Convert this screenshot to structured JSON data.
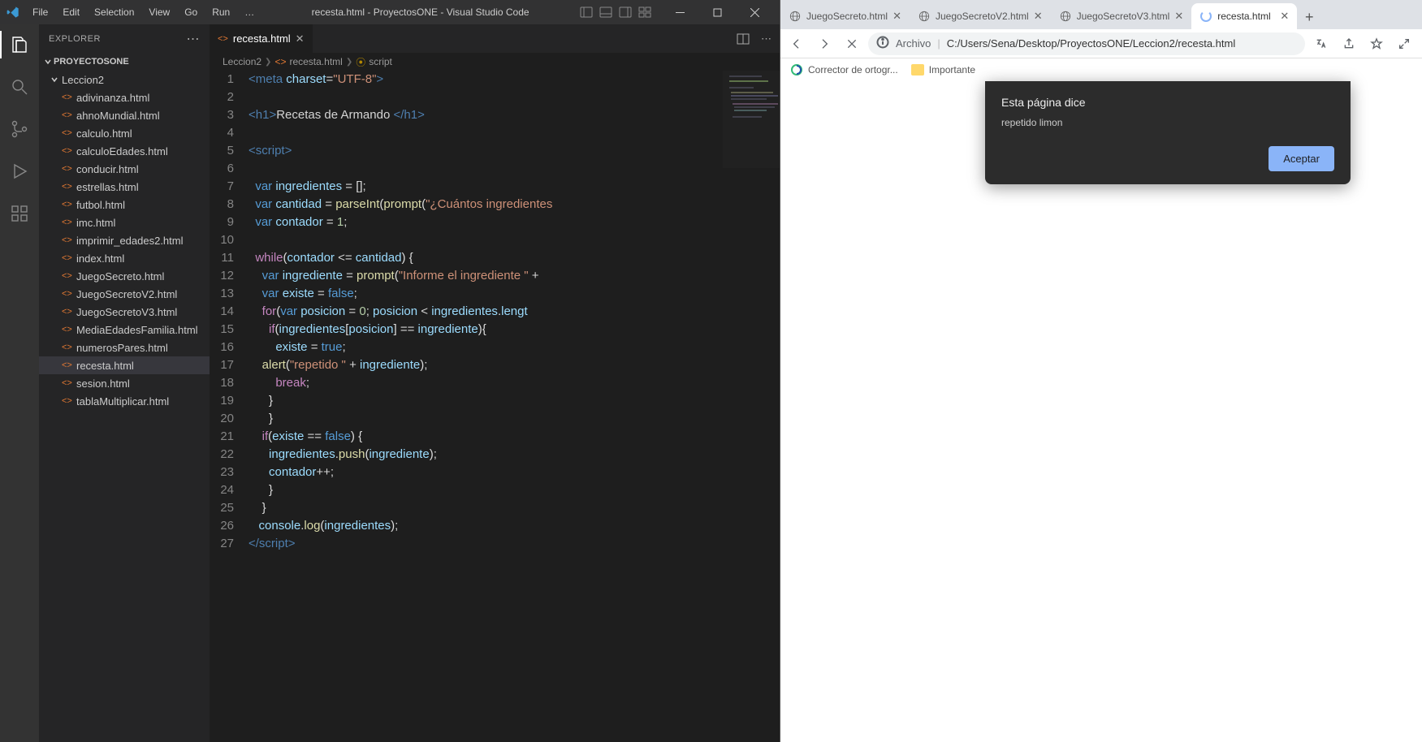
{
  "vscode": {
    "menus": [
      "File",
      "Edit",
      "Selection",
      "View",
      "Go",
      "Run",
      "…"
    ],
    "window_title": "recesta.html - ProyectosONE - Visual Studio Code",
    "explorer_label": "EXPLORER",
    "project_name": "PROYECTOSONE",
    "folder_name": "Leccion2",
    "files": [
      "adivinanza.html",
      "ahnoMundial.html",
      "calculo.html",
      "calculoEdades.html",
      "conducir.html",
      "estrellas.html",
      "futbol.html",
      "imc.html",
      "imprimir_edades2.html",
      "index.html",
      "JuegoSecreto.html",
      "JuegoSecretoV2.html",
      "JuegoSecretoV3.html",
      "MediaEdadesFamilia.html",
      "numerosPares.html",
      "recesta.html",
      "sesion.html",
      "tablaMultiplicar.html"
    ],
    "selected_file": "recesta.html",
    "open_tab": "recesta.html",
    "breadcrumbs": {
      "folder": "Leccion2",
      "file": "recesta.html",
      "symbol": "script"
    },
    "code_lines": [
      {
        "n": 1,
        "html": "<span class='hl-tag'>&lt;meta</span> <span class='hl-attr'>charset</span><span class='hl-eq'>=</span><span class='hl-val'>\"UTF-8\"</span><span class='hl-tag'>&gt;</span>"
      },
      {
        "n": 2,
        "html": ""
      },
      {
        "n": 3,
        "html": "<span class='hl-tag'>&lt;h1&gt;</span><span class='hl-h1txt'>Recetas de Armando </span><span class='hl-tag'>&lt;/h1&gt;</span>"
      },
      {
        "n": 4,
        "html": ""
      },
      {
        "n": 5,
        "html": "<span class='hl-tag'>&lt;script&gt;</span>"
      },
      {
        "n": 6,
        "html": ""
      },
      {
        "n": 7,
        "html": "  <span class='hl-kw2'>var</span> <span class='hl-attr'>ingredientes</span> <span class='hl-eq'>=</span> <span class='hl-br'>[]</span>;"
      },
      {
        "n": 8,
        "html": "  <span class='hl-kw2'>var</span> <span class='hl-attr'>cantidad</span> <span class='hl-eq'>=</span> <span class='hl-fn'>parseInt</span><span class='hl-br'>(</span><span class='hl-fn'>prompt</span><span class='hl-br'>(</span><span class='hl-val'>\"¿Cuántos ingredientes</span>"
      },
      {
        "n": 9,
        "html": "  <span class='hl-kw2'>var</span> <span class='hl-attr'>contador</span> <span class='hl-eq'>=</span> <span class='hl-num'>1</span>;"
      },
      {
        "n": 10,
        "html": ""
      },
      {
        "n": 11,
        "html": "  <span class='hl-kw'>while</span><span class='hl-br'>(</span><span class='hl-attr'>contador</span> <span class='hl-eq'>&lt;=</span> <span class='hl-attr'>cantidad</span><span class='hl-br'>)</span> <span class='hl-br'>{</span>"
      },
      {
        "n": 12,
        "html": "    <span class='hl-kw2'>var</span> <span class='hl-attr'>ingrediente</span> <span class='hl-eq'>=</span> <span class='hl-fn'>prompt</span><span class='hl-br'>(</span><span class='hl-val'>\"Informe el ingrediente \"</span> <span class='hl-eq'>+</span>"
      },
      {
        "n": 13,
        "html": "    <span class='hl-kw2'>var</span> <span class='hl-attr'>existe</span> <span class='hl-eq'>=</span> <span class='hl-kw2'>false</span>;"
      },
      {
        "n": 14,
        "html": "    <span class='hl-kw'>for</span><span class='hl-br'>(</span><span class='hl-kw2'>var</span> <span class='hl-attr'>posicion</span> <span class='hl-eq'>=</span> <span class='hl-num'>0</span>; <span class='hl-attr'>posicion</span> <span class='hl-eq'>&lt;</span> <span class='hl-attr'>ingredientes</span>.<span class='hl-attr'>lengt</span>"
      },
      {
        "n": 15,
        "html": "      <span class='hl-kw'>if</span><span class='hl-br'>(</span><span class='hl-attr'>ingredientes</span><span class='hl-br'>[</span><span class='hl-attr'>posicion</span><span class='hl-br'>]</span> <span class='hl-eq'>==</span> <span class='hl-attr'>ingrediente</span><span class='hl-br'>){</span>"
      },
      {
        "n": 16,
        "html": "        <span class='hl-attr'>existe</span> <span class='hl-eq'>=</span> <span class='hl-kw2'>true</span>;"
      },
      {
        "n": 17,
        "html": "    <span class='hl-fn'>alert</span><span class='hl-br'>(</span><span class='hl-val'>\"repetido \"</span> <span class='hl-eq'>+</span> <span class='hl-attr'>ingrediente</span><span class='hl-br'>)</span>;"
      },
      {
        "n": 18,
        "html": "        <span class='hl-kw'>break</span>;"
      },
      {
        "n": 19,
        "html": "      <span class='hl-br'>}</span>"
      },
      {
        "n": 20,
        "html": "      <span class='hl-br'>}</span>"
      },
      {
        "n": 21,
        "html": "    <span class='hl-kw'>if</span><span class='hl-br'>(</span><span class='hl-attr'>existe</span> <span class='hl-eq'>==</span> <span class='hl-kw2'>false</span><span class='hl-br'>)</span> <span class='hl-br'>{</span>"
      },
      {
        "n": 22,
        "html": "      <span class='hl-attr'>ingredientes</span>.<span class='hl-fn'>push</span><span class='hl-br'>(</span><span class='hl-attr'>ingrediente</span><span class='hl-br'>)</span>;"
      },
      {
        "n": 23,
        "html": "      <span class='hl-attr'>contador</span><span class='hl-eq'>++</span>;"
      },
      {
        "n": 24,
        "html": "      <span class='hl-br'>}</span>"
      },
      {
        "n": 25,
        "html": "    <span class='hl-br'>}</span>"
      },
      {
        "n": 26,
        "html": "   <span class='hl-attr'>console</span>.<span class='hl-fn'>log</span><span class='hl-br'>(</span><span class='hl-attr'>ingredientes</span><span class='hl-br'>)</span>;"
      },
      {
        "n": 27,
        "html": "<span class='hl-tag'>&lt;/script&gt;</span>"
      }
    ]
  },
  "browser": {
    "tabs": [
      {
        "label": "JuegoSecreto.html",
        "active": false,
        "favtype": "globe"
      },
      {
        "label": "JuegoSecretoV2.html",
        "active": false,
        "favtype": "globe"
      },
      {
        "label": "JuegoSecretoV3.html",
        "active": false,
        "favtype": "globe"
      },
      {
        "label": "recesta.html",
        "active": true,
        "favtype": "spinner"
      }
    ],
    "archivo_label": "Archivo",
    "url": "C:/Users/Sena/Desktop/ProyectosONE/Leccion2/recesta.html",
    "bookmarks": [
      {
        "label": "Corrector de ortogr...",
        "icon": "swirl"
      },
      {
        "label": "Importante",
        "icon": "folder"
      }
    ],
    "dialog": {
      "title": "Esta página dice",
      "message": "repetido limon",
      "ok": "Aceptar"
    }
  }
}
